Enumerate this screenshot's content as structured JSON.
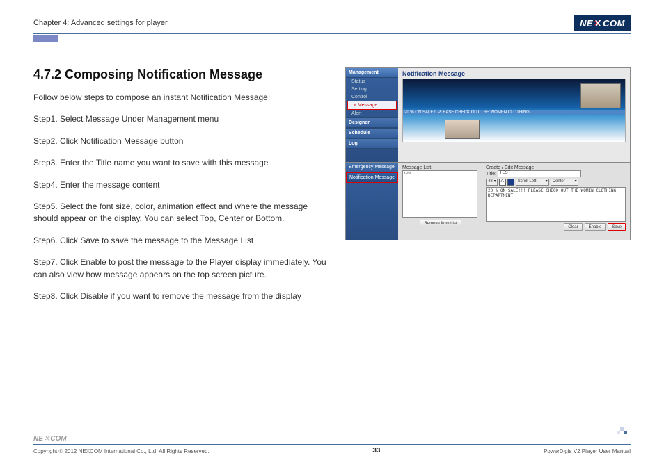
{
  "header": {
    "chapter": "Chapter 4: Advanced settings for player",
    "logo_ne": "NE",
    "logo_com": "COM"
  },
  "section": {
    "heading": "4.7.2 Composing Notification Message",
    "intro": "Follow below steps to compose an instant Notification Message:",
    "step1": "Step1. Select Message Under Management menu",
    "step2": "Step2. Click Notification Message button",
    "step3": "Step3. Enter the Title name you want to save with this message",
    "step4": "Step4. Enter the message content",
    "step5": "Step5. Select the font size, color, animation effect and where the message should appear on the display. You can select Top, Center or Bottom.",
    "step6": "Step6. Click Save to save the message to the Message List",
    "step7": "Step7. Click Enable to post the message to the Player display immediately. You can also view how message appears on the top screen picture.",
    "step8": "Step8. Click Disable if you want to remove the message from the display"
  },
  "screenshot": {
    "sidebar": {
      "management": "Management",
      "status": "Status",
      "setting": "Setting",
      "control": "Control",
      "message": "» Message",
      "alert": "Alert",
      "designer": "Designer",
      "schedule": "Schedule",
      "log": "Log"
    },
    "main_title": "Notification Message",
    "ticker": "20 % ON SALE!!! PLEASE CHECK OUT THE WOMEN CLOTHING",
    "bottom_side": {
      "emergency": "Emergency Message",
      "notification": "Notification Message"
    },
    "bottom_main": {
      "list_label": "Message List:",
      "list_item": "test",
      "create_label": "Create / Edit Message",
      "title_label": "Title:",
      "title_value": "TEST",
      "font_size": "48",
      "font_color_a": "A",
      "scroll": "Scroll Left",
      "position": "Center",
      "content": "20 % ON SALE!!! PLEASE CHECK OUT THE WOMEN CLOTHING DEPARTMENT",
      "remove_btn": "Remove from List",
      "clear_btn": "Clear",
      "enable_btn": "Enable",
      "save_btn": "Save"
    }
  },
  "footer": {
    "copyright": "Copyright © 2012 NEXCOM International Co., Ltd. All Rights Reserved.",
    "page": "33",
    "doc": "PowerDigis V2 Player User Manual"
  }
}
